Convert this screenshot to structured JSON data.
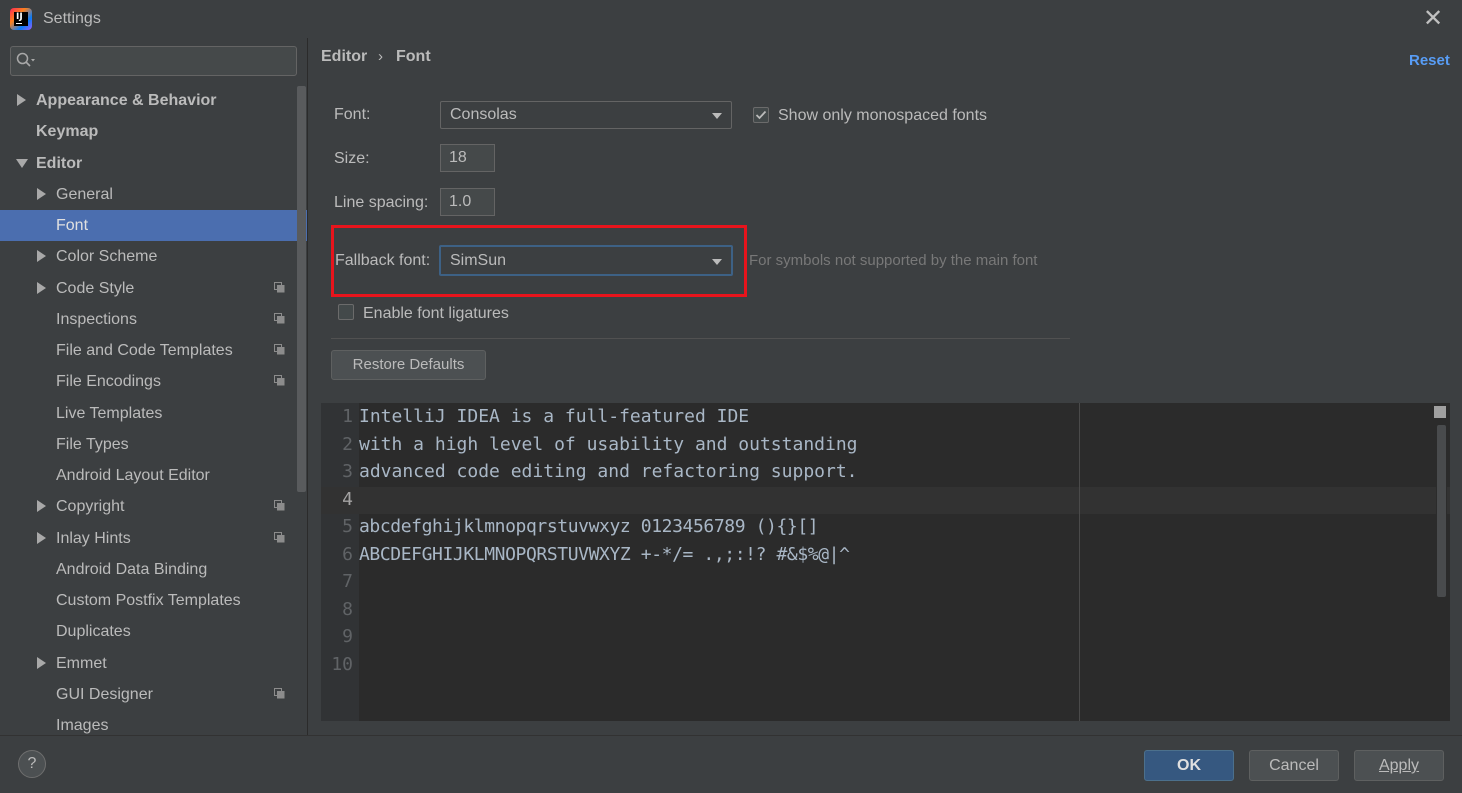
{
  "window": {
    "title": "Settings",
    "close_glyph": "✕"
  },
  "sidebar": {
    "search": {
      "value": "",
      "placeholder": ""
    },
    "items": [
      {
        "label": "Appearance & Behavior",
        "bold": true,
        "expanded": false
      },
      {
        "label": "Keymap",
        "bold": true
      },
      {
        "label": "Editor",
        "bold": true,
        "expanded": true
      },
      {
        "label": "General",
        "expanded": false
      },
      {
        "label": "Font",
        "selected": true
      },
      {
        "label": "Color Scheme",
        "expanded": false
      },
      {
        "label": "Code Style",
        "expanded": false,
        "project_icon": true
      },
      {
        "label": "Inspections",
        "project_icon": true
      },
      {
        "label": "File and Code Templates",
        "project_icon": true
      },
      {
        "label": "File Encodings",
        "project_icon": true
      },
      {
        "label": "Live Templates"
      },
      {
        "label": "File Types"
      },
      {
        "label": "Android Layout Editor"
      },
      {
        "label": "Copyright",
        "expanded": false,
        "project_icon": true
      },
      {
        "label": "Inlay Hints",
        "expanded": false,
        "project_icon": true
      },
      {
        "label": "Android Data Binding"
      },
      {
        "label": "Custom Postfix Templates"
      },
      {
        "label": "Duplicates"
      },
      {
        "label": "Emmet",
        "expanded": false
      },
      {
        "label": "GUI Designer",
        "project_icon": true
      },
      {
        "label": "Images"
      }
    ]
  },
  "header": {
    "breadcrumb": [
      "Editor",
      "Font"
    ],
    "breadcrumb_separator": "›",
    "reset_label": "Reset"
  },
  "form": {
    "font_label": "Font:",
    "font_value": "Consolas",
    "monospace_label": "Show only monospaced fonts",
    "monospace_checked": true,
    "size_label": "Size:",
    "size_value": "18",
    "line_spacing_label": "Line spacing:",
    "line_spacing_value": "1.0",
    "fallback_label": "Fallback font:",
    "fallback_value": "SimSun",
    "fallback_hint": "For symbols not supported by the main font",
    "ligatures_label": "Enable font ligatures",
    "ligatures_checked": false,
    "restore_label": "Restore Defaults"
  },
  "preview": {
    "line_numbers": [
      "1",
      "2",
      "3",
      "4",
      "5",
      "6",
      "7",
      "8",
      "9",
      "10"
    ],
    "lines": [
      "IntelliJ IDEA is a full-featured IDE",
      "with a high level of usability and outstanding",
      "advanced code editing and refactoring support.",
      "",
      "abcdefghijklmnopqrstuvwxyz 0123456789 (){}[]",
      "ABCDEFGHIJKLMNOPQRSTUVWXYZ +-*/= .,;:!? #&$%@|^"
    ],
    "current_line": 4
  },
  "footer": {
    "help_label": "?",
    "ok_label": "OK",
    "cancel_label": "Cancel",
    "apply_label": "Apply"
  },
  "colors": {
    "background": "#3c3f41",
    "selection": "#4b6eaf",
    "link": "#589df6",
    "highlight": "#e8141c",
    "primary_button": "#365880"
  }
}
